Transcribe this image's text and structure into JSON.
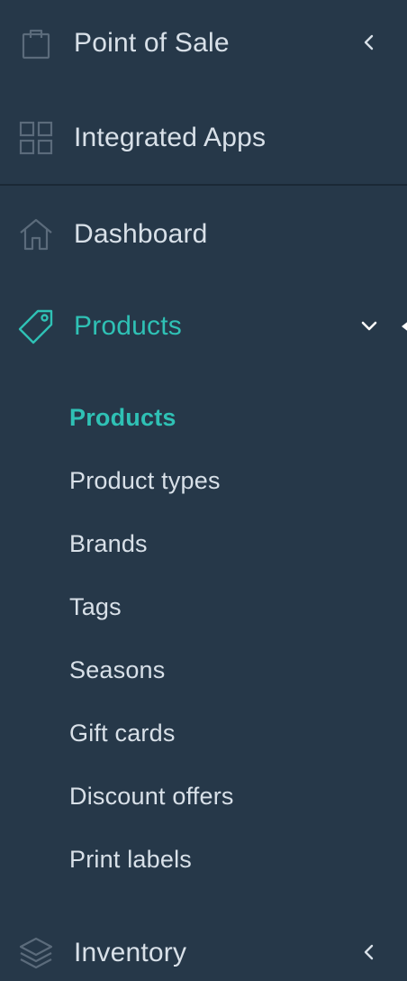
{
  "colors": {
    "background": "#263849",
    "text": "#d8e0e8",
    "accent": "#2fc1b5",
    "icon": "#5b6b7b"
  },
  "nav": {
    "point_of_sale": {
      "label": "Point of Sale",
      "icon": "shopping-bag-icon",
      "chevron": "chevron-left-icon"
    },
    "integrated_apps": {
      "label": "Integrated Apps",
      "icon": "grid-apps-icon"
    },
    "dashboard": {
      "label": "Dashboard",
      "icon": "home-icon"
    },
    "products": {
      "label": "Products",
      "icon": "tag-icon",
      "chevron": "chevron-down-icon",
      "active": true
    },
    "inventory": {
      "label": "Inventory",
      "icon": "layers-icon",
      "chevron": "chevron-left-icon"
    }
  },
  "products_submenu": [
    {
      "label": "Products",
      "active": true
    },
    {
      "label": "Product types"
    },
    {
      "label": "Brands"
    },
    {
      "label": "Tags"
    },
    {
      "label": "Seasons"
    },
    {
      "label": "Gift cards"
    },
    {
      "label": "Discount offers"
    },
    {
      "label": "Print labels"
    }
  ]
}
